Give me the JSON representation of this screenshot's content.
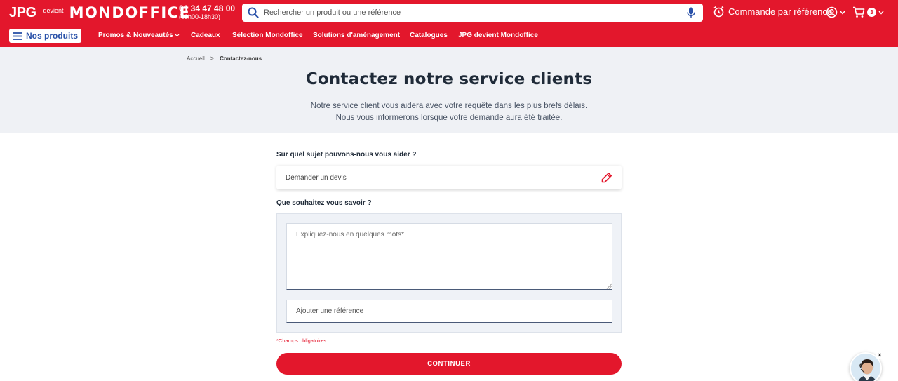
{
  "header": {
    "logo": {
      "jpg": "JPG",
      "devient": "devient",
      "brand": "MONDOFFICE"
    },
    "phone": {
      "number": "01 34 47 48 00",
      "hours": "(08h00-18h30)"
    },
    "search": {
      "placeholder": "Rechercher un produit ou une référence"
    },
    "order_by_reference": "Commande par référence",
    "cart": {
      "count": "3"
    },
    "colors": {
      "brand_red": "#e3172c",
      "nav_blue": "#2850a8"
    }
  },
  "nav": {
    "products_button": "Nos produits",
    "items": [
      "Promos & Nouveautés",
      "Cadeaux",
      "Sélection Mondoffice",
      "Solutions d'aménagement",
      "Catalogues",
      "JPG devient Mondoffice"
    ]
  },
  "breadcrumb": {
    "home": "Accueil",
    "current": "Contactez-nous"
  },
  "hero": {
    "title": "Contactez notre service clients",
    "line1": "Notre service client vous aidera avec votre requête dans les plus brefs délais.",
    "line2": "Nous vous informerons lorsque votre demande aura été traitée."
  },
  "form": {
    "subject_label": "Sur quel sujet pouvons-nous vous aider ?",
    "subject_value": "Demander un devis",
    "question_label": "Que souhaitez vous savoir ?",
    "message_placeholder": "Expliquez-nous en quelques mots*",
    "reference_placeholder": "Ajouter une référence",
    "required_note": "*Champs obligatoires",
    "continue_label": "CONTINUER"
  },
  "chat_widget": {
    "close_symbol": "×"
  }
}
